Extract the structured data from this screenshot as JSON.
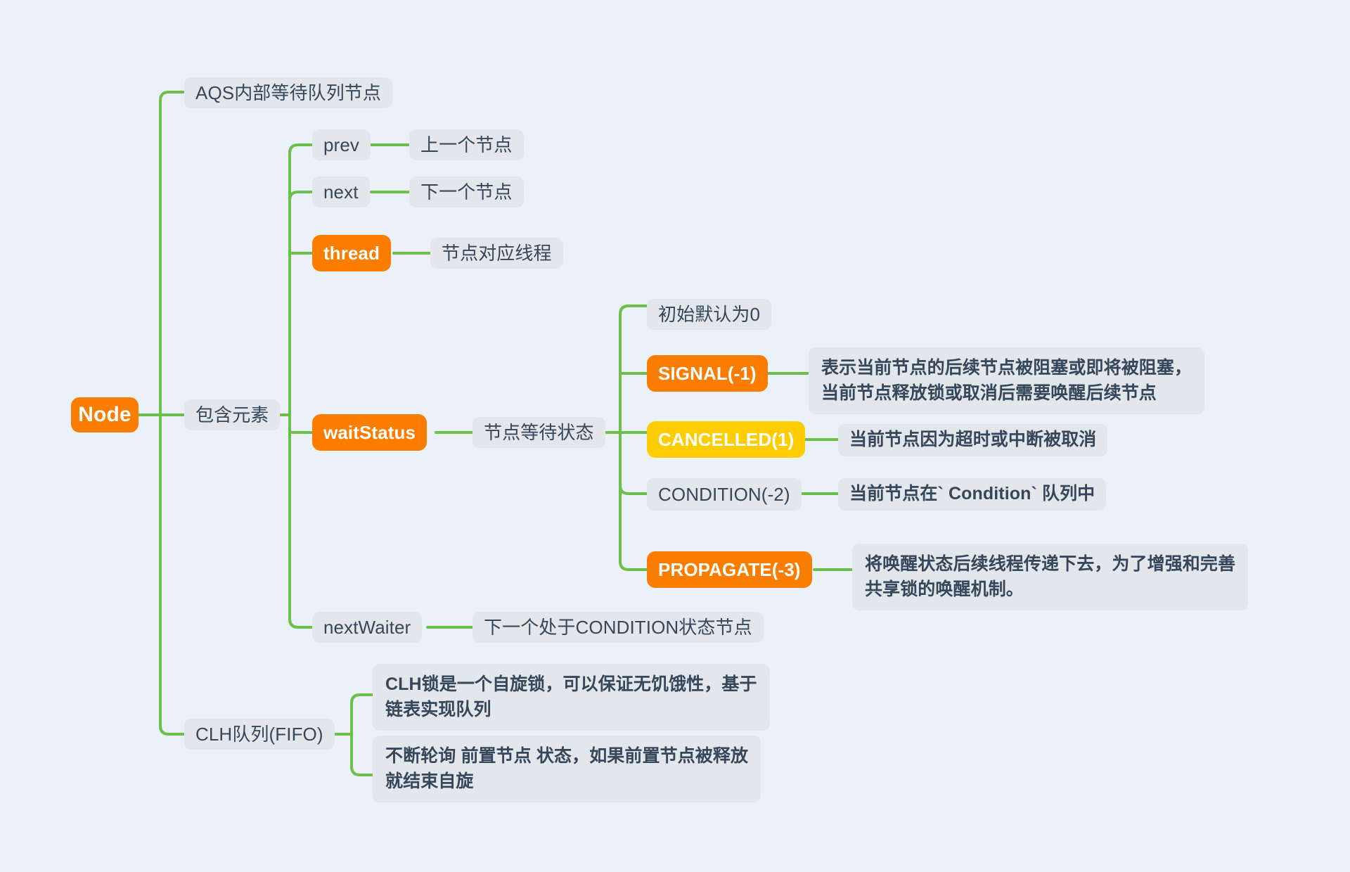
{
  "theme": {
    "background": "#eaf1f9",
    "branch_color": "#6cc04a",
    "plain_node_bg": "#e3e6ea",
    "plain_node_text": "#36475b",
    "orange": "#fa7d00",
    "yellow": "#ffcc00",
    "highlight_text": "#ffffff"
  },
  "mindmap": {
    "root": {
      "label": "Node",
      "style": "orange"
    },
    "branches": [
      {
        "label": "AQS内部等待队列节点",
        "style": "plain",
        "children": []
      },
      {
        "label": "包含元素",
        "style": "plain",
        "children": [
          {
            "label": "prev",
            "style": "plain",
            "children": [
              {
                "label": "上一个节点",
                "style": "plain",
                "children": []
              }
            ]
          },
          {
            "label": "next",
            "style": "plain",
            "children": [
              {
                "label": "下一个节点",
                "style": "plain",
                "children": []
              }
            ]
          },
          {
            "label": "thread",
            "style": "orange",
            "children": [
              {
                "label": "节点对应线程",
                "style": "plain",
                "children": []
              }
            ]
          },
          {
            "label": "waitStatus",
            "style": "orange",
            "children": [
              {
                "label": "节点等待状态",
                "style": "plain",
                "children": [
                  {
                    "label": "初始默认为0",
                    "style": "plain",
                    "children": []
                  },
                  {
                    "label": "SIGNAL(-1)",
                    "style": "orange",
                    "children": [
                      {
                        "label": "表示当前节点的后续节点被阻塞或即将被阻塞，\n当前节点释放锁或取消后需要唤醒后续节点",
                        "style": "bold-dark",
                        "children": []
                      }
                    ]
                  },
                  {
                    "label": "CANCELLED(1)",
                    "style": "yellow",
                    "children": [
                      {
                        "label": "当前节点因为超时或中断被取消",
                        "style": "bold-dark",
                        "children": []
                      }
                    ]
                  },
                  {
                    "label": "CONDITION(-2)",
                    "style": "plain",
                    "children": [
                      {
                        "label": "当前节点在` Condition` 队列中",
                        "style": "bold-dark",
                        "children": []
                      }
                    ]
                  },
                  {
                    "label": "PROPAGATE(-3)",
                    "style": "orange",
                    "children": [
                      {
                        "label": "将唤醒状态后续线程传递下去，为了增强和完善\n共享锁的唤醒机制。",
                        "style": "bold-dark",
                        "children": []
                      }
                    ]
                  }
                ]
              }
            ]
          },
          {
            "label": "nextWaiter",
            "style": "plain",
            "children": [
              {
                "label": "下一个处于CONDITION状态节点",
                "style": "plain",
                "children": []
              }
            ]
          }
        ]
      },
      {
        "label": "CLH队列(FIFO)",
        "style": "plain",
        "children": [
          {
            "label": "CLH锁是一个自旋锁，可以保证无饥饿性，基于\n链表实现队列",
            "style": "bold-dark",
            "children": []
          },
          {
            "label": "不断轮询 前置节点 状态，如果前置节点被释放\n就结束自旋",
            "style": "bold-dark",
            "children": []
          }
        ]
      }
    ]
  },
  "nodes": {
    "root": "Node",
    "aqs_desc": "AQS内部等待队列节点",
    "contains": "包含元素",
    "prev": "prev",
    "prev_desc": "上一个节点",
    "next": "next",
    "next_desc": "下一个节点",
    "thread": "thread",
    "thread_desc": "节点对应线程",
    "wait_status": "waitStatus",
    "wait_status_desc": "节点等待状态",
    "ws_default": "初始默认为0",
    "ws_signal": "SIGNAL(-1)",
    "ws_signal_desc": "表示当前节点的后续节点被阻塞或即将被阻塞，\n当前节点释放锁或取消后需要唤醒后续节点",
    "ws_cancelled": "CANCELLED(1)",
    "ws_cancelled_desc": "当前节点因为超时或中断被取消",
    "ws_condition": "CONDITION(-2)",
    "ws_condition_desc": "当前节点在` Condition` 队列中",
    "ws_propagate": "PROPAGATE(-3)",
    "ws_propagate_desc": "将唤醒状态后续线程传递下去，为了增强和完善\n共享锁的唤醒机制。",
    "next_waiter": "nextWaiter",
    "next_waiter_desc": "下一个处于CONDITION状态节点",
    "clh": "CLH队列(FIFO)",
    "clh_desc1": "CLH锁是一个自旋锁，可以保证无饥饿性，基于\n链表实现队列",
    "clh_desc2": "不断轮询 前置节点 状态，如果前置节点被释放\n就结束自旋"
  }
}
